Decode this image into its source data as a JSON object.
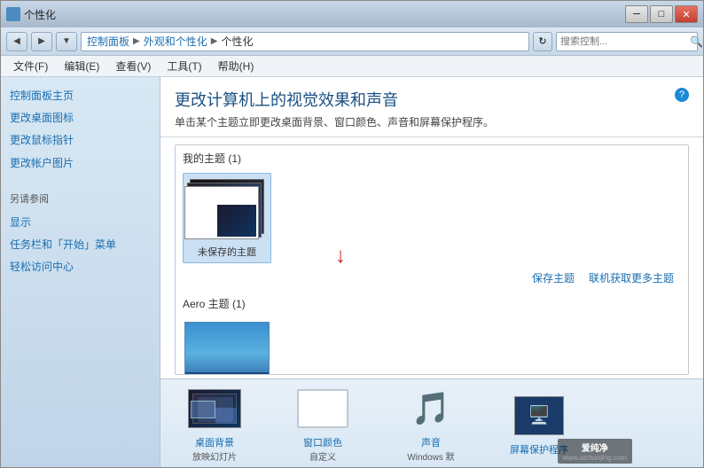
{
  "window": {
    "title": "个性化",
    "controls": {
      "minimize": "─",
      "maximize": "□",
      "close": "✕"
    }
  },
  "addressBar": {
    "back": "◀",
    "forward": "▶",
    "dropdown": "▼",
    "pathParts": [
      "控制面板",
      "外观和个性化",
      "个性化"
    ],
    "refresh": "↻",
    "searchPlaceholder": "搜索控制..."
  },
  "menuBar": {
    "items": [
      "文件(F)",
      "编辑(E)",
      "查看(V)",
      "工具(T)",
      "帮助(H)"
    ]
  },
  "sidebar": {
    "mainLink": "控制面板主页",
    "links": [
      "更改桌面图标",
      "更改鼠标指针",
      "更改帐户图片"
    ],
    "seeAlsoLabel": "另请参阅",
    "seeAlsoLinks": [
      "显示",
      "任务栏和「开始」菜单",
      "轻松访问中心"
    ]
  },
  "content": {
    "title": "更改计算机上的视觉效果和声音",
    "description": "单击某个主题立即更改桌面背景、窗口颜色、声音和屏幕保护程序。",
    "helpIcon": "?",
    "themePanel": {
      "myThemesLabel": "我的主题 (1)",
      "unsavedThemeLabel": "未保存的主题",
      "saveLink": "保存主题",
      "onlineLink": "联机获取更多主题",
      "aeroLabel": "Aero 主题 (1)"
    }
  },
  "bottomBar": {
    "items": [
      {
        "label": "桌面背景",
        "sublabel": "放映幻灯片",
        "icon": "desktop-background"
      },
      {
        "label": "窗口颜色",
        "sublabel": "自定义",
        "icon": "window-color"
      },
      {
        "label": "声音",
        "sublabel": "Windows 默",
        "icon": "sound"
      },
      {
        "label": "屏幕保护程序",
        "sublabel": "",
        "icon": "screensaver"
      }
    ]
  },
  "watermark": {
    "text": "爱纯净",
    "url": "www.aichunjing.com"
  }
}
